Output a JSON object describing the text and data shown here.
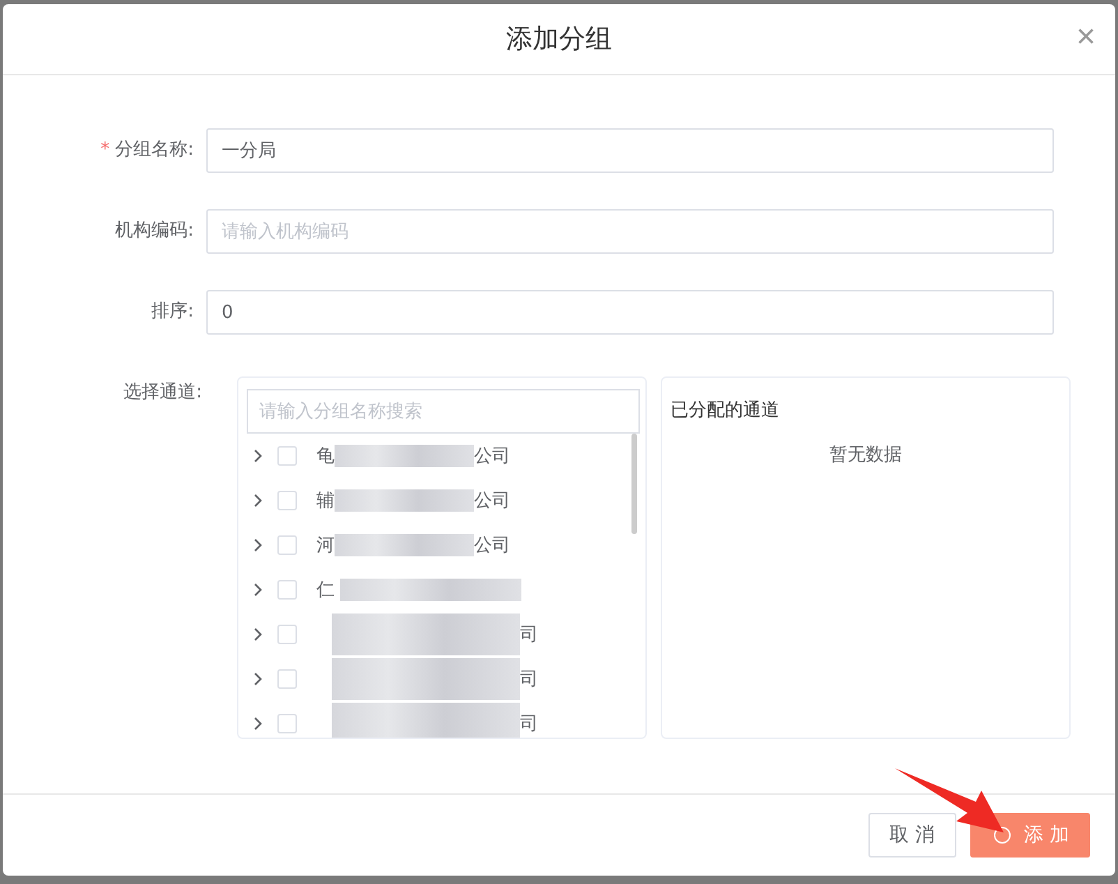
{
  "dialog": {
    "title": "添加分组",
    "close": "×"
  },
  "fields": [
    {
      "kind": "text",
      "label": "分组名称:",
      "required_mark": "*",
      "value": "一分局"
    },
    {
      "kind": "text",
      "label": "机构编码:",
      "placeholder": "请输入机构编码"
    },
    {
      "kind": "text",
      "label": "排序:",
      "value": "0"
    },
    {
      "kind": "transfer",
      "label": "选择通道:"
    }
  ],
  "transfer": {
    "search": {
      "placeholder": "请输入分组名称搜索"
    },
    "items": [
      {
        "prefix": "龟",
        "suffix": "公司",
        "expanded": false,
        "checked": false
      },
      {
        "prefix": "辅",
        "suffix": "公司",
        "expanded": false,
        "checked": false
      },
      {
        "prefix": "河",
        "suffix": "公司",
        "expanded": false,
        "checked": false
      },
      {
        "prefix": "仁",
        "expanded": false,
        "checked": false
      },
      {
        "suffix": "司",
        "expanded": false,
        "checked": false
      },
      {
        "suffix": "司",
        "expanded": false,
        "checked": false
      },
      {
        "suffix": "司",
        "expanded": false,
        "checked": false
      }
    ],
    "assigned_title": "已分配的通道",
    "empty_text": "暂无数据"
  },
  "buttons": [
    {
      "kind": "cancel",
      "label": "取 消",
      "loading": false
    },
    {
      "kind": "primary",
      "label": "添 加",
      "loading": true
    }
  ]
}
